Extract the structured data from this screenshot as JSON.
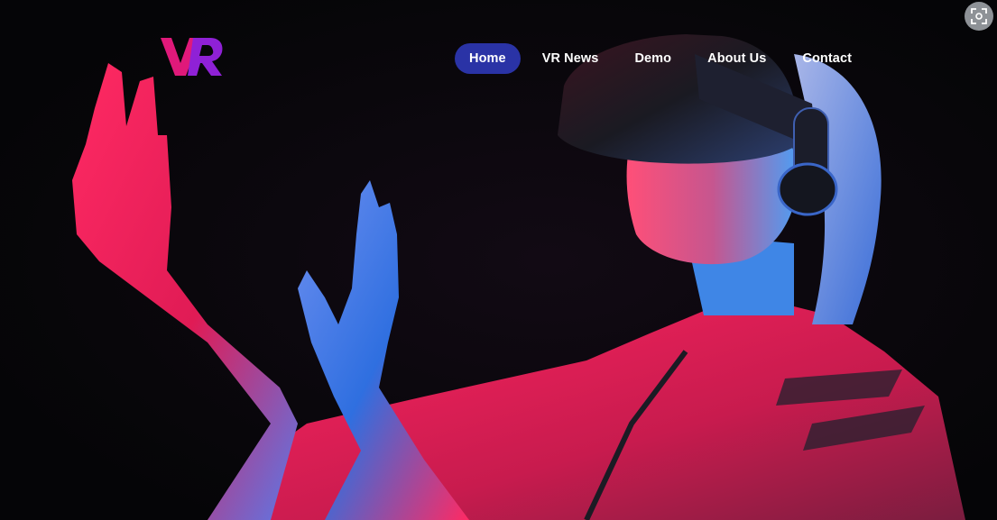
{
  "brand": {
    "logo_text": "VR",
    "logo_colors": [
      "#e0197a",
      "#8f21d6"
    ]
  },
  "nav": {
    "items": [
      {
        "label": "Home",
        "active": true
      },
      {
        "label": "VR News",
        "active": false
      },
      {
        "label": "Demo",
        "active": false
      },
      {
        "label": "About Us",
        "active": false
      },
      {
        "label": "Contact",
        "active": false
      }
    ],
    "active_color": "#2a33a6"
  },
  "hero": {
    "image_subject": "woman wearing VR headset reaching out with both hands, neon pink and blue lighting",
    "colors": {
      "background": "#050507",
      "neon_pink": "#ff1f5a",
      "neon_blue": "#2f7df0"
    }
  },
  "overlay": {
    "icon": "screen-capture-icon"
  }
}
